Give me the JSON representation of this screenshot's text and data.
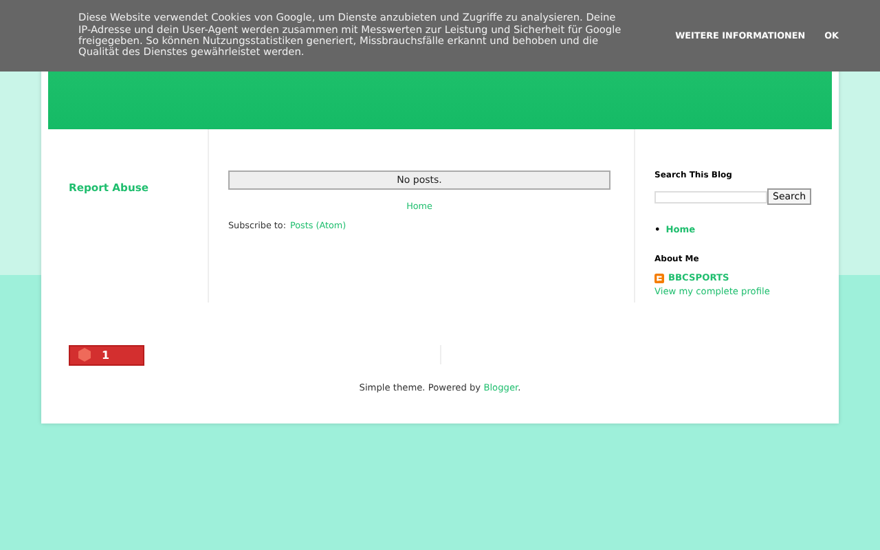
{
  "cookie_banner": {
    "text": "Diese Website verwendet Cookies von Google, um Dienste anzubieten und Zugriffe zu analysieren. Deine IP-Adresse und dein User-Agent werden zusammen mit Messwerten zur Leistung und Sicherheit für Google freigegeben. So können Nutzungsstatistiken generiert, Missbrauchsfälle erkannt und behoben und die Qualität des Dienstes gewährleistet werden.",
    "buttons": [
      "WEITERE INFORMATIONEN",
      "OK"
    ]
  },
  "left_column": {
    "report_abuse": "Report Abuse",
    "badge_count": "1"
  },
  "main": {
    "status": "No posts.",
    "home_link": "Home",
    "subscribe_label": "Subscribe to:",
    "subscribe_link": "Posts (Atom)"
  },
  "sidebar": {
    "search_title": "Search This Blog",
    "search_button": "Search",
    "pages": [
      {
        "bullet": "•",
        "label": "Home"
      }
    ],
    "about_title": "About Me",
    "profile_name": "BBCSPORTS",
    "profile_link": "View my complete profile"
  },
  "footer": {
    "text": "Simple theme. Powered by ",
    "link": "Blogger",
    "end": "."
  }
}
